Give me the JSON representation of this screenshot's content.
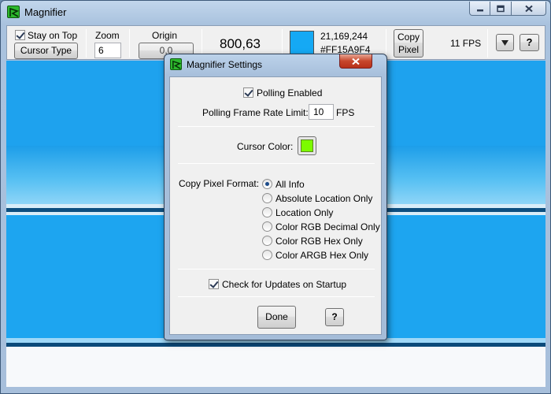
{
  "window": {
    "title": "Magnifier"
  },
  "toolbar": {
    "stay_on_top_label": "Stay on Top",
    "stay_on_top_checked": true,
    "cursor_type_label": "Cursor Type",
    "zoom_label": "Zoom",
    "zoom_value": "6",
    "origin_label": "Origin",
    "origin_value": "0,0",
    "cursor_coords": "800,63",
    "color_swatch": "#15A9F4",
    "color_decimal": "21,169,244",
    "color_hex": "#FF15A9F4",
    "copy_pixel_line1": "Copy",
    "copy_pixel_line2": "Pixel",
    "fps": "11 FPS",
    "dropdown_icon": "triangle-down",
    "help_label": "?"
  },
  "settings_dialog": {
    "title": "Magnifier Settings",
    "polling_enabled_label": "Polling Enabled",
    "polling_enabled_checked": true,
    "frame_rate_label": "Polling Frame Rate Limit:",
    "frame_rate_value": "10",
    "frame_rate_unit": "FPS",
    "cursor_color_label": "Cursor Color:",
    "cursor_color": "#7CFC00",
    "copy_format_label": "Copy Pixel Format:",
    "copy_format_options": [
      "All Info",
      "Absolute Location Only",
      "Location Only",
      "Color RGB Decimal Only",
      "Color RGB Hex Only",
      "Color ARGB Hex Only"
    ],
    "copy_format_selected": "All Info",
    "check_updates_label": "Check for Updates on Startup",
    "check_updates_checked": true,
    "done_label": "Done",
    "help_label": "?"
  }
}
